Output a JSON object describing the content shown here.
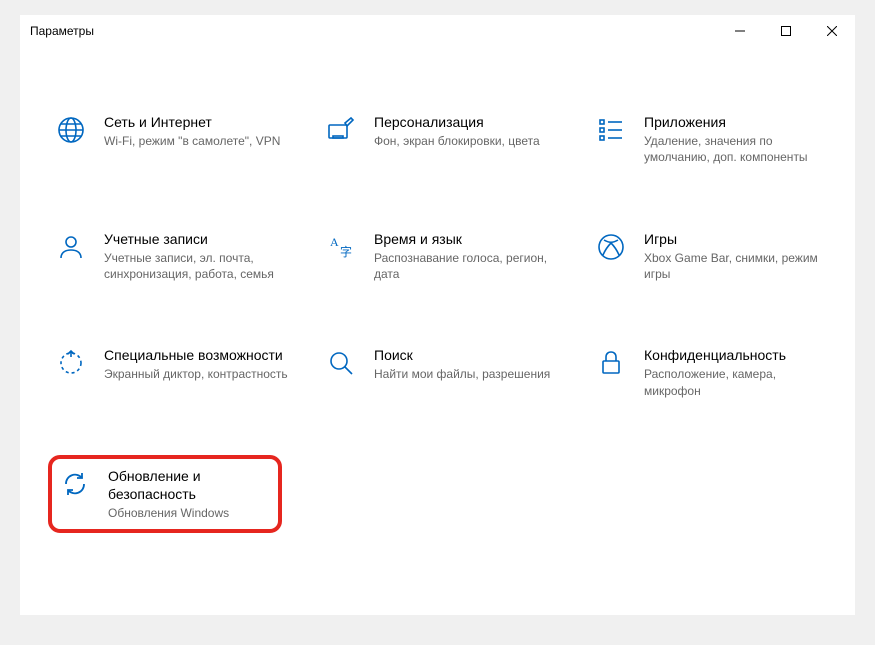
{
  "window": {
    "title": "Параметры"
  },
  "tiles": {
    "network": {
      "title": "Сеть и Интернет",
      "desc": "Wi-Fi, режим \"в самолете\", VPN"
    },
    "personal": {
      "title": "Персонализация",
      "desc": "Фон, экран блокировки, цвета"
    },
    "apps": {
      "title": "Приложения",
      "desc": "Удаление, значения по умолчанию, доп. компоненты"
    },
    "accounts": {
      "title": "Учетные записи",
      "desc": "Учетные записи, эл. почта, синхронизация, работа, семья"
    },
    "timelang": {
      "title": "Время и язык",
      "desc": "Распознавание голоса, регион, дата"
    },
    "gaming": {
      "title": "Игры",
      "desc": "Xbox Game Bar, снимки, режим игры"
    },
    "access": {
      "title": "Специальные возможности",
      "desc": "Экранный диктор, контрастность"
    },
    "search": {
      "title": "Поиск",
      "desc": "Найти мои файлы, разрешения"
    },
    "privacy": {
      "title": "Конфиденциальность",
      "desc": "Расположение, камера, микрофон"
    },
    "update": {
      "title": "Обновление и безопасность",
      "desc": "Обновления Windows"
    }
  }
}
